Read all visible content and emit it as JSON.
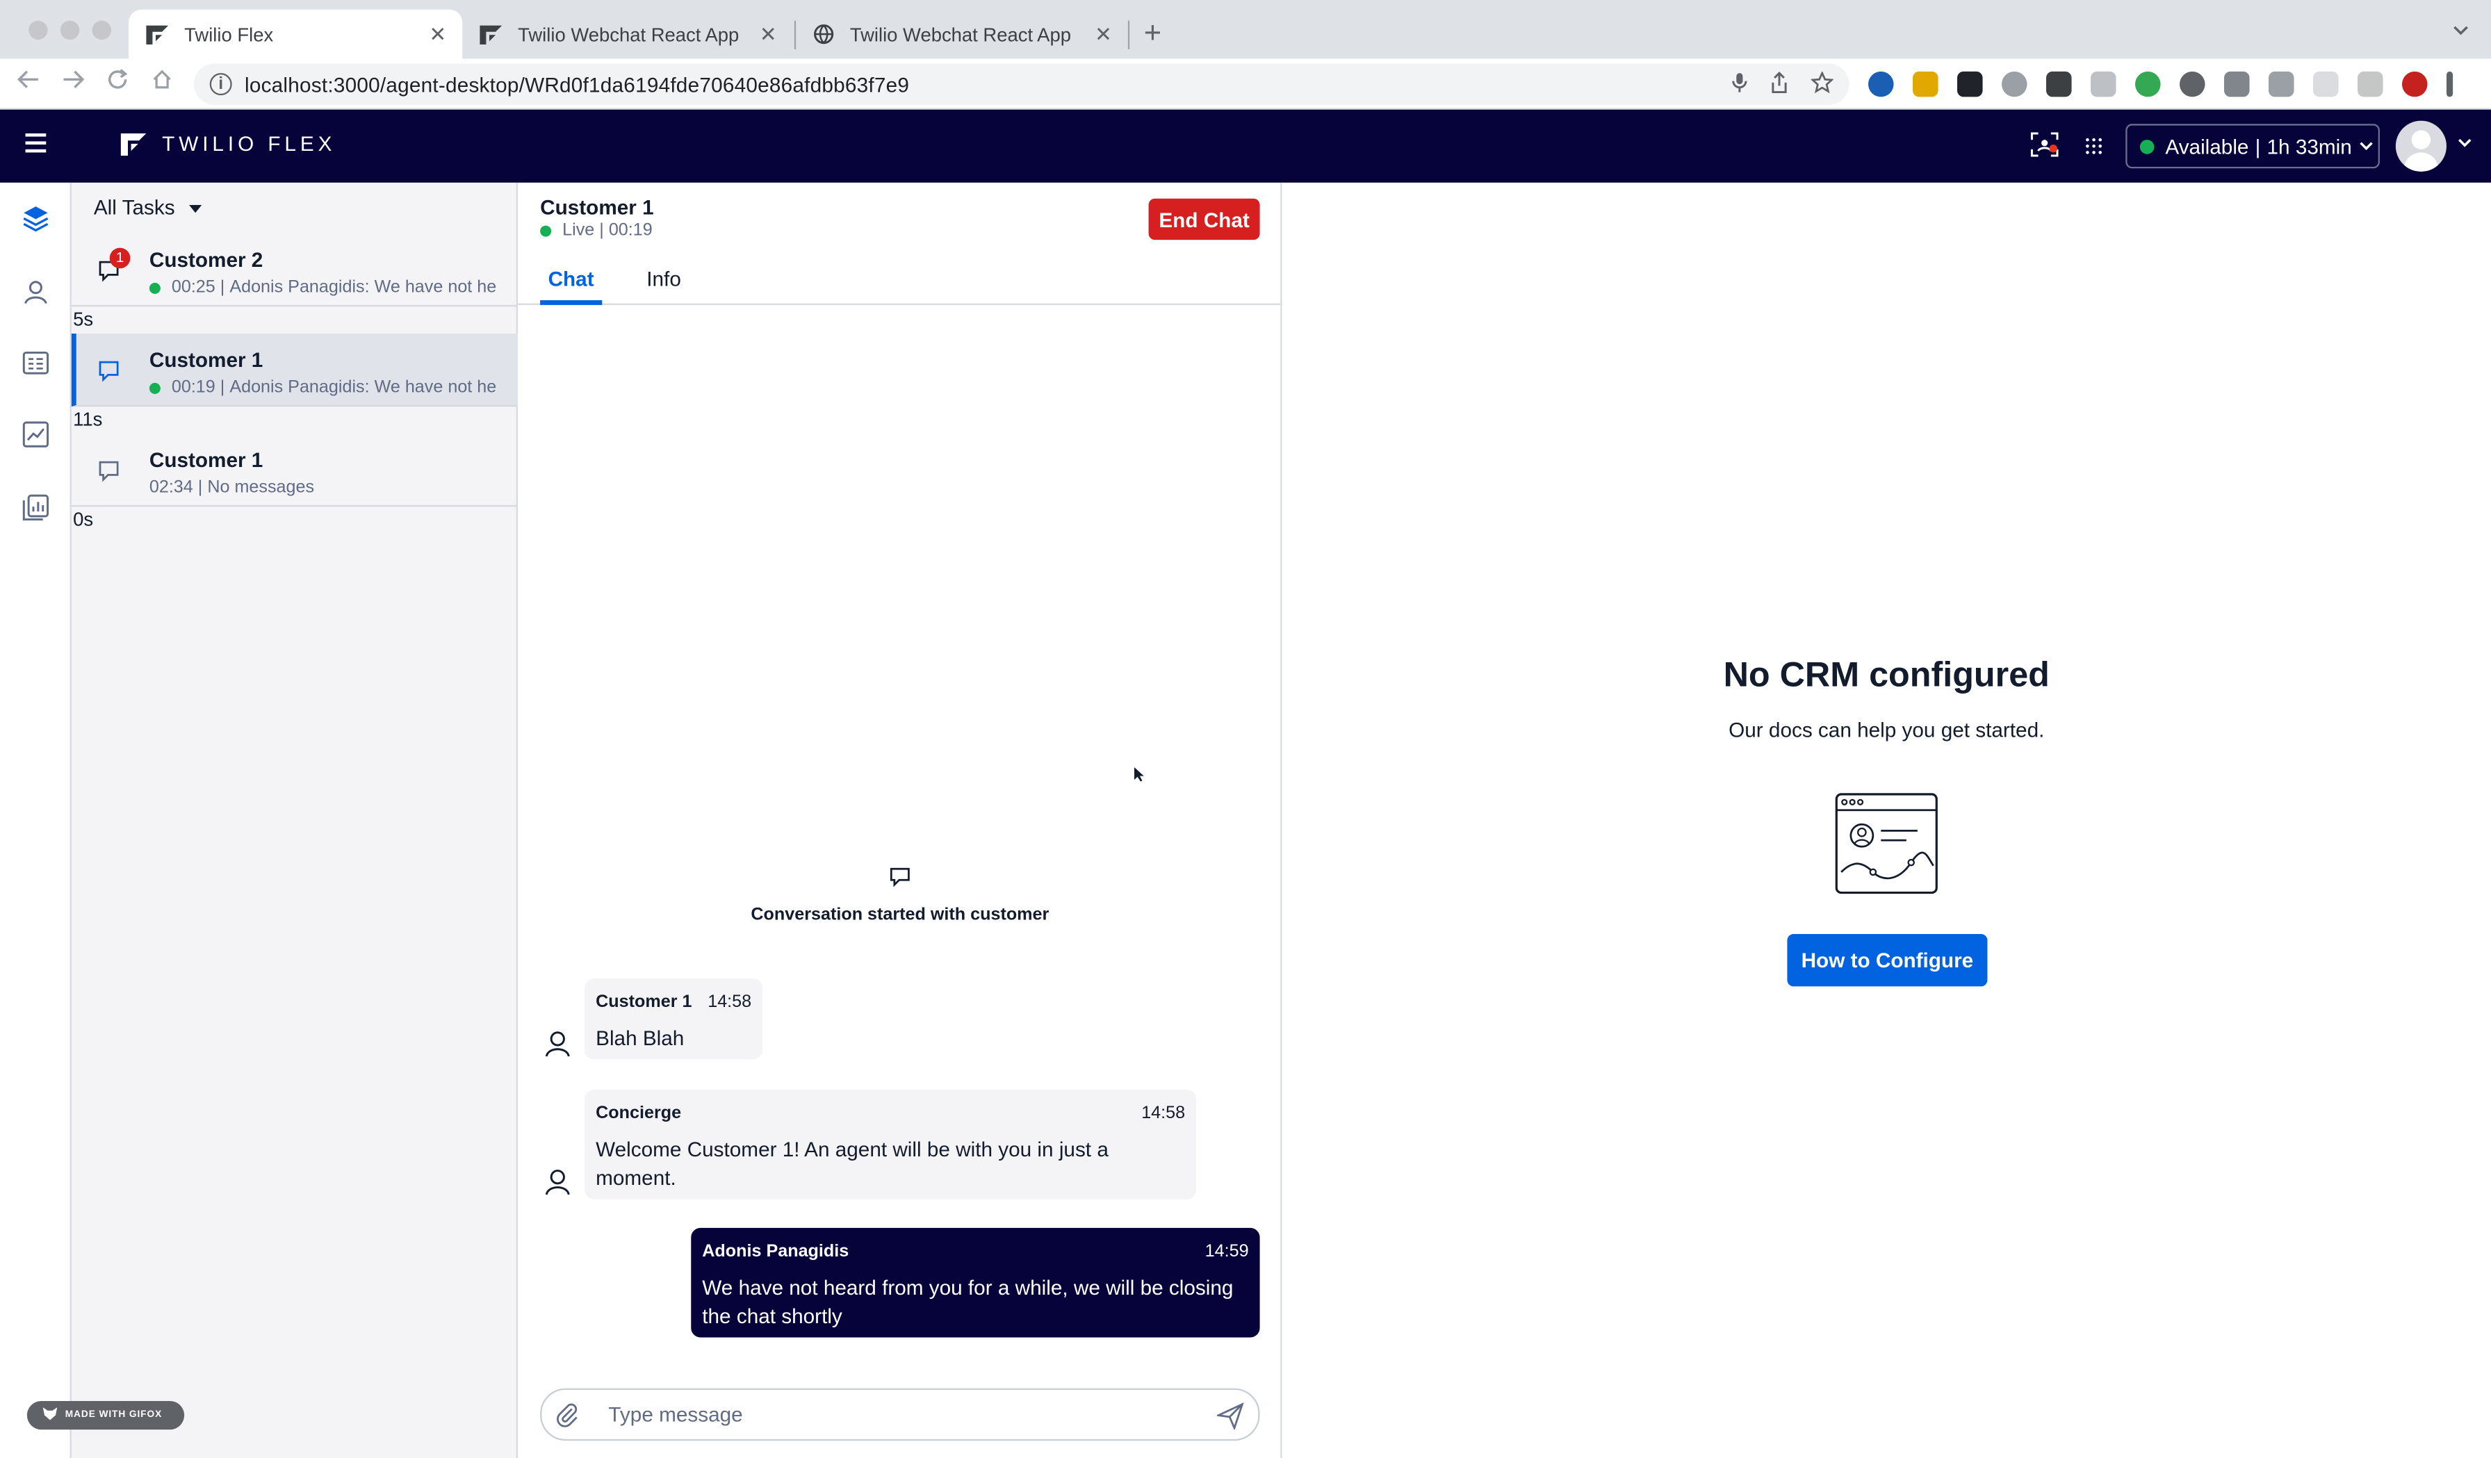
{
  "browser": {
    "tabs": [
      {
        "title": "Twilio Flex",
        "active": true
      },
      {
        "title": "Twilio Webchat React App",
        "active": false
      },
      {
        "title": "Twilio Webchat React App",
        "active": false
      }
    ],
    "new_tab": "+",
    "url": "localhost:3000/agent-desktop/WRd0f1da6194fde70640e86afdbb63f7e9",
    "close_glyph": "✕"
  },
  "header": {
    "brand": "TWILIO FLEX",
    "status": "Available",
    "status_time": "1h 33min",
    "status_sep": "|",
    "colors": {
      "header_bg": "#06033a",
      "available": "#14b053"
    }
  },
  "sidenav": {
    "items": [
      "layers-icon",
      "contacts-icon",
      "queues-icon",
      "insights-icon",
      "analytics-icon"
    ]
  },
  "tasklist": {
    "filter": "All Tasks",
    "tasks": [
      {
        "name": "Customer 2",
        "time": "00:25",
        "preview": "Adonis Panagidis: We have not he",
        "badge": "1",
        "age": "5s",
        "live": true
      },
      {
        "name": "Customer 1",
        "time": "00:19",
        "preview": "Adonis Panagidis: We have not he",
        "badge": "",
        "age": "11s",
        "live": true,
        "selected": true
      },
      {
        "name": "Customer 1",
        "time": "02:34",
        "preview": "No messages",
        "badge": "",
        "age": "0s",
        "live": false
      }
    ]
  },
  "chat": {
    "customer": "Customer 1",
    "status": "Live",
    "duration": "00:19",
    "end_label": "End Chat",
    "tabs": {
      "chat": "Chat",
      "info": "Info"
    },
    "conversation_start": "Conversation started with customer",
    "messages": [
      {
        "author": "Customer 1",
        "time": "14:58",
        "text": "Blah Blah"
      },
      {
        "author": "Concierge",
        "time": "14:58",
        "text_line1": "Welcome Customer 1! An agent will be with you in just a",
        "text_line2": "moment."
      },
      {
        "author": "Adonis Panagidis",
        "time": "14:59",
        "text_line1": "We have not heard from you for a while, we will be closing",
        "text_line2": "the chat shortly"
      }
    ],
    "composer_placeholder": "Type message"
  },
  "crm": {
    "title": "No CRM configured",
    "subtitle": "Our docs can help you get started.",
    "button": "How to Configure"
  },
  "watermark": "MADE WITH GIFOX"
}
